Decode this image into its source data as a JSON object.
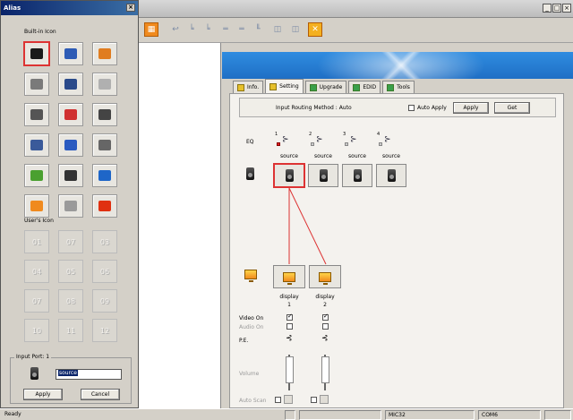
{
  "alias": {
    "title": "Alias",
    "close": "×",
    "builtin_label": "Built-in Icon",
    "users_label": "User's Icon",
    "builtin_icons": [
      {
        "name": "speaker-icon",
        "color": "#1a1a1a"
      },
      {
        "name": "laptop-icon",
        "color": "#2d5bb5"
      },
      {
        "name": "server-icon",
        "color": "#e07d20"
      },
      {
        "name": "projector-icon",
        "color": "#7a7a7a"
      },
      {
        "name": "desktop-computer-icon",
        "color": "#2a4a8a"
      },
      {
        "name": "disc-icon",
        "color": "#b0b0b0"
      },
      {
        "name": "microphone-icon",
        "color": "#555555"
      },
      {
        "name": "headphones-icon",
        "color": "#d03030"
      },
      {
        "name": "gamepad-icon",
        "color": "#444444"
      },
      {
        "name": "dvd-player-icon",
        "color": "#3a5a9a"
      },
      {
        "name": "screen-icon",
        "color": "#2a5ac0"
      },
      {
        "name": "cd-icon",
        "color": "#666666"
      },
      {
        "name": "picture-icon",
        "color": "#4aa030"
      },
      {
        "name": "camera-icon",
        "color": "#333333"
      },
      {
        "name": "tv-icon",
        "color": "#1e66c8"
      },
      {
        "name": "monitor-icon",
        "color": "#f08a1e"
      },
      {
        "name": "vcr-icon",
        "color": "#9a9a9a"
      },
      {
        "name": "delete-icon",
        "color": "#e03010"
      }
    ],
    "user_slots": [
      "01",
      "07",
      "03",
      "04",
      "05",
      "06",
      "07",
      "08",
      "09",
      "10",
      "11",
      "12"
    ],
    "input_port_label": "Input Port: 1",
    "name_value": "source",
    "apply": "Apply",
    "cancel": "Cancel"
  },
  "tabs": [
    "Info.",
    "Setting",
    "Upgrade",
    "EDID",
    "Tools"
  ],
  "routing": {
    "label": "Input Routing Method : Auto",
    "auto_apply": "Auto Apply",
    "apply": "Apply",
    "get": "Get"
  },
  "eq_label": "EQ",
  "eq_numbers": [
    "1",
    "2",
    "3",
    "4"
  ],
  "sources": [
    "source",
    "source",
    "source",
    "source"
  ],
  "displays": [
    {
      "label": "display",
      "num": "1"
    },
    {
      "label": "display",
      "num": "2"
    }
  ],
  "rows": {
    "video_on": "Video On",
    "audio_on": "Audio On",
    "pe": "P.E.",
    "volume": "Volume",
    "auto_scan": "Auto Scan"
  },
  "status": {
    "ready": "Ready",
    "mic": "MIC32",
    "com": "COM6"
  },
  "window_buttons": [
    "_",
    "□",
    "×"
  ],
  "colors": {
    "accent_orange": "#f08a1e",
    "banner_blue": "#1f6fc5",
    "selection_red": "#dd3333"
  }
}
